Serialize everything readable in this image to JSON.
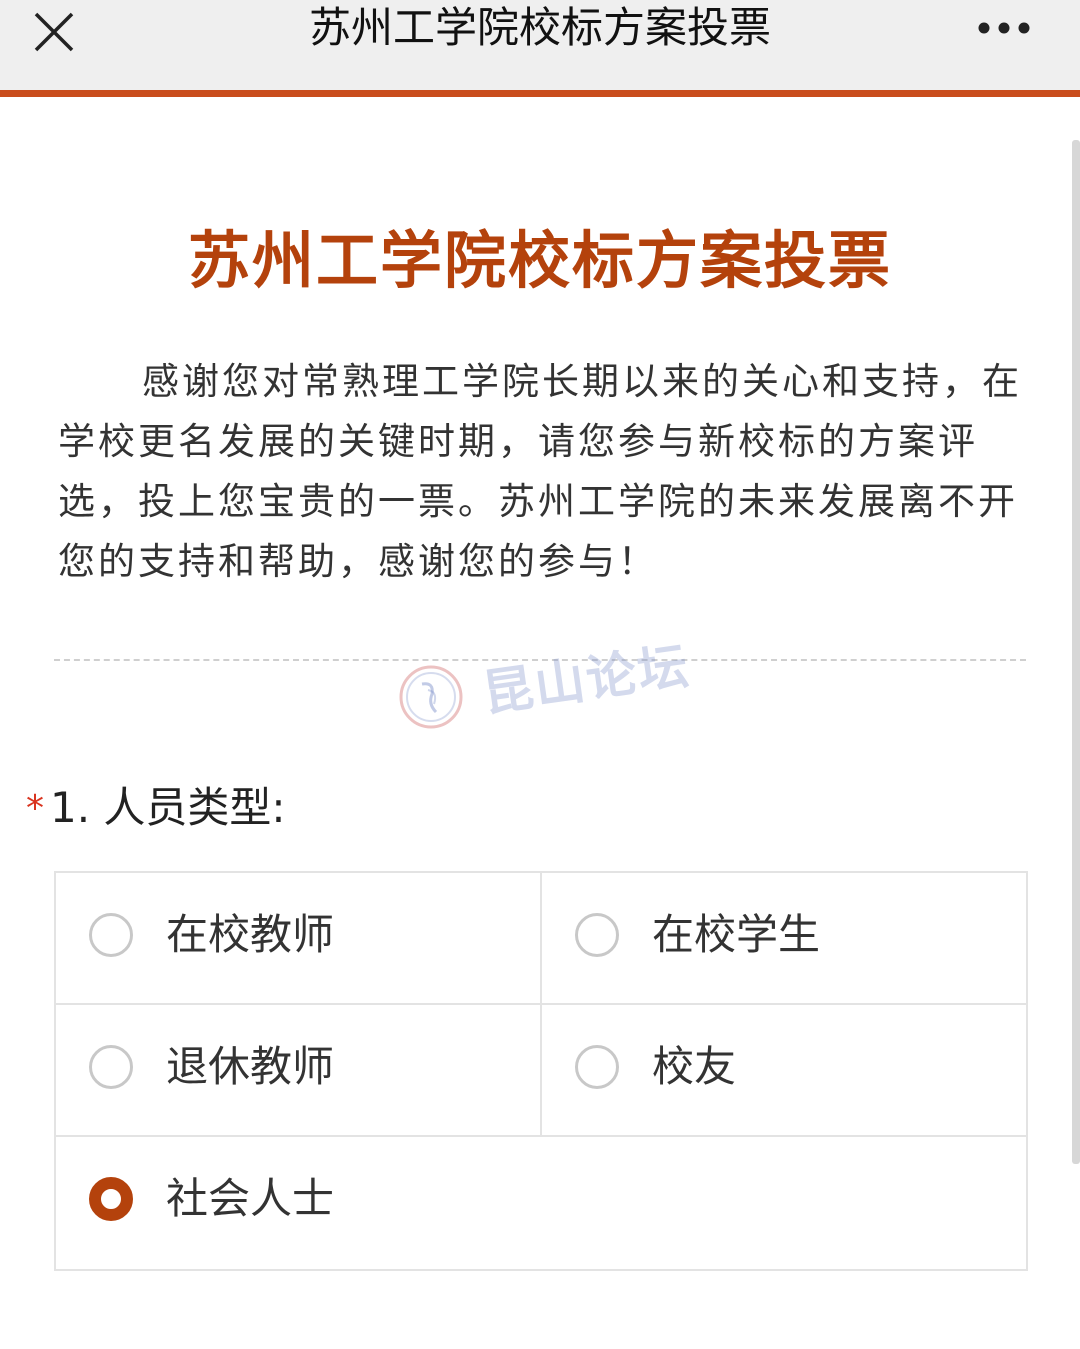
{
  "header": {
    "title": "苏州工学院校标方案投票",
    "close_icon": "close-icon",
    "more_icon": "more-dots-icon"
  },
  "survey": {
    "heading": "苏州工学院校标方案投票",
    "intro": "感谢您对常熟理工学院长期以来的关心和支持，在学校更名发展的关键时期，请您参与新校标的方案评选，投上您宝贵的一票。苏州工学院的未来发展离不开您的支持和帮助，感谢您的参与！"
  },
  "watermark": {
    "text": "昆山论坛"
  },
  "question": {
    "required_mark": "*",
    "title": "1. 人员类型:",
    "options": [
      {
        "label": "在校教师",
        "checked": false
      },
      {
        "label": "在校学生",
        "checked": false
      },
      {
        "label": "退休教师",
        "checked": false
      },
      {
        "label": "校友",
        "checked": false
      },
      {
        "label": "社会人士",
        "checked": true
      }
    ]
  },
  "colors": {
    "accent": "#b4420c",
    "header_line": "#c94d1d",
    "required": "#d9341f"
  }
}
